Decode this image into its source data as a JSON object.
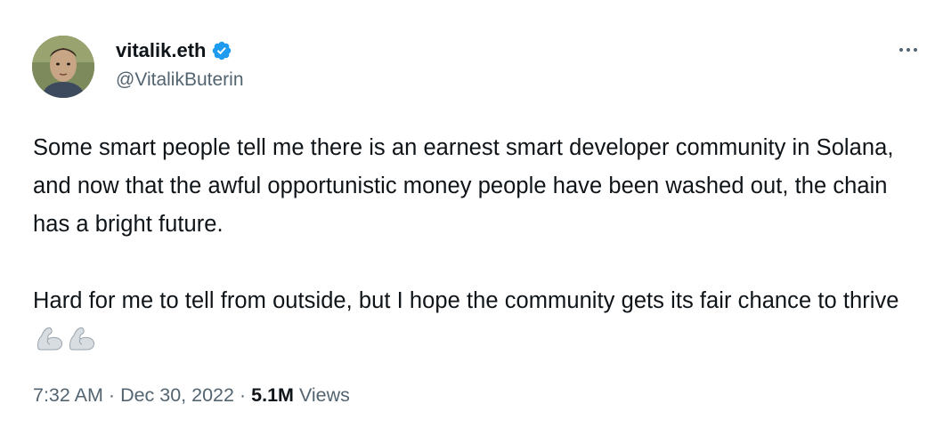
{
  "author": {
    "display_name": "vitalik.eth",
    "handle": "@VitalikButerin",
    "verified": true,
    "avatar_icon": "avatar-photo"
  },
  "tweet": {
    "paragraph_1": "Some smart people tell me there is an earnest smart developer community in Solana, and now that the awful opportunistic money people have been washed out, the chain has a bright future.",
    "paragraph_2": "Hard for me to tell from outside, but I hope the community gets its fair chance to thrive",
    "emojis": [
      "flexed-biceps-icon",
      "flexed-biceps-icon"
    ]
  },
  "meta": {
    "time": "7:32 AM",
    "separator": "·",
    "date": "Dec 30, 2022",
    "views_count": "5.1M",
    "views_label": "Views"
  },
  "colors": {
    "text_primary": "#0f1419",
    "text_secondary": "#536471",
    "verified_blue": "#1d9bf0"
  },
  "icons": {
    "more": "more-icon",
    "verified": "verified-badge-icon"
  }
}
